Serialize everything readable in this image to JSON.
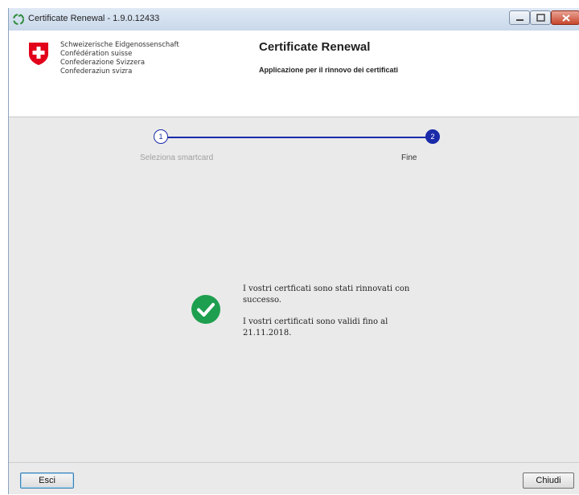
{
  "window": {
    "title": "Certificate Renewal - 1.9.0.12433",
    "app_icon": "recycle-icon",
    "controls": [
      "minimize-icon",
      "maximize-icon",
      "close-icon"
    ]
  },
  "header": {
    "agency_lines": [
      "Schweizerische Eidgenossenschaft",
      "Confédération suisse",
      "Confederazione Svizzera",
      "Confederaziun svizra"
    ],
    "crest_icon": "swiss-cross-icon",
    "title": "Certificate Renewal",
    "subtitle": "Applicazione per il rinnovo dei certificati"
  },
  "stepper": {
    "steps": [
      {
        "number": "1",
        "label": "Seleziona smartcard",
        "state": "done"
      },
      {
        "number": "2",
        "label": "Fine",
        "state": "current"
      }
    ],
    "accent": "#1a2aa8"
  },
  "result": {
    "icon": "success-check-icon",
    "icon_color": "#1e9f4f",
    "line1": "I vostri certficati sono stati rinnovati con successo.",
    "line2": "I vostri certificati sono validi fino al 21.11.2018."
  },
  "footer": {
    "exit_label": "Esci",
    "close_label": "Chiudi"
  }
}
